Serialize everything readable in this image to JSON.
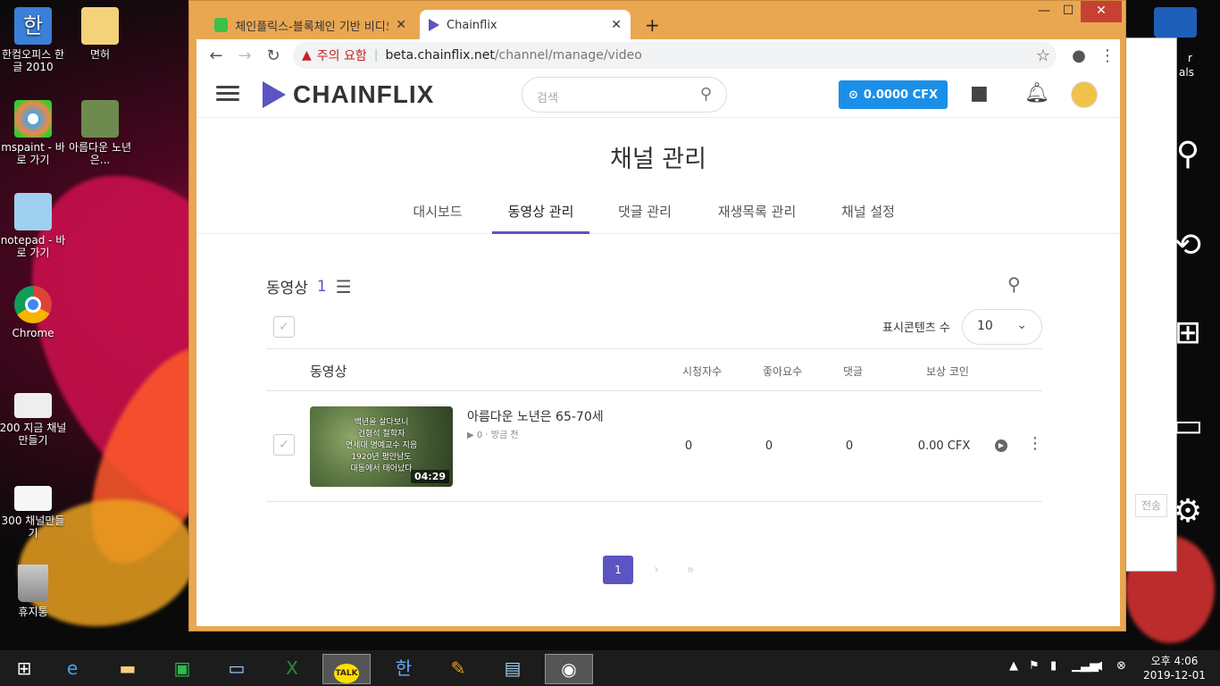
{
  "desktop": {
    "icons": [
      {
        "label": "한컴오피스 한글 2010",
        "icon": "hwp-icon"
      },
      {
        "label": "면허",
        "icon": "folder-icon"
      },
      {
        "label": "mspaint - 바로 가기",
        "icon": "paint-icon"
      },
      {
        "label": "아름다운 노년은...",
        "icon": "video-icon"
      },
      {
        "label": "notepad - 바로 가기",
        "icon": "notepad-icon"
      },
      {
        "label": "Chrome",
        "icon": "chrome-icon"
      },
      {
        "label": "200 지금 채널 만들기",
        "icon": "image-icon"
      },
      {
        "label": "300 채널만들기",
        "icon": "image-icon"
      },
      {
        "label": "휴지통",
        "icon": "recycle-bin-icon"
      }
    ],
    "partial_right_labels": [
      "r",
      "als"
    ],
    "bg_window_button": "전송"
  },
  "browser": {
    "tabs": [
      {
        "label": "체인플릭스-블록체인 기반 비디오",
        "close": "✕"
      },
      {
        "label": "Chainflix",
        "close": "✕"
      }
    ],
    "new_tab": "+",
    "controls": {
      "minimize": "—",
      "maximize": "☐",
      "close": "✕"
    },
    "address": {
      "warning": "주의 요함",
      "host": "beta.chainflix.net",
      "path": "/channel/manage/video"
    }
  },
  "site": {
    "logo": "CHAINFLIX",
    "search_placeholder": "검색",
    "cfx_balance": "0.0000 CFX",
    "page_title": "채널 관리",
    "tabs": [
      "대시보드",
      "동영상 관리",
      "댓글 관리",
      "재생목록 관리",
      "채널 설정"
    ],
    "active_tab": "동영상 관리",
    "video_count_label": "동영상",
    "video_count": "1",
    "per_page_label": "표시콘텐츠 수",
    "per_page_value": "10",
    "table_headers": {
      "video": "동영상",
      "views": "시청자수",
      "likes": "좋아요수",
      "comments": "댓글",
      "reward": "보상 코인"
    },
    "rows": [
      {
        "title": "아름다운 노년은 65-70세",
        "meta": "▶ 0 · 방금 전",
        "duration": "04:29",
        "thumb_caption": "백년을 살다보니 / 건형석 철학자 / 연세대 명예교수 지음 / 1920년 평안남도 / 대동에서 태어났다",
        "views": "0",
        "likes": "0",
        "comments": "0",
        "reward": "0.00 CFX"
      }
    ],
    "pagination": {
      "current": "1",
      "next": "›",
      "last": "»"
    }
  },
  "taskbar": {
    "clock_period_time": "오후 4:06",
    "clock_date": "2019-12-01",
    "items": [
      "start-icon",
      "ie-icon",
      "explorer-icon",
      "store-icon",
      "lenovo-icon",
      "excel-icon",
      "kakaotalk-icon",
      "hwp-icon",
      "paint-icon",
      "notepad-icon",
      "chrome-icon"
    ],
    "kakao_label": "TALK"
  },
  "colors": {
    "accent": "#5b54c2",
    "cfx_button": "#1b8fe8",
    "window_frame": "#e9a752",
    "close_button": "#c84031"
  }
}
